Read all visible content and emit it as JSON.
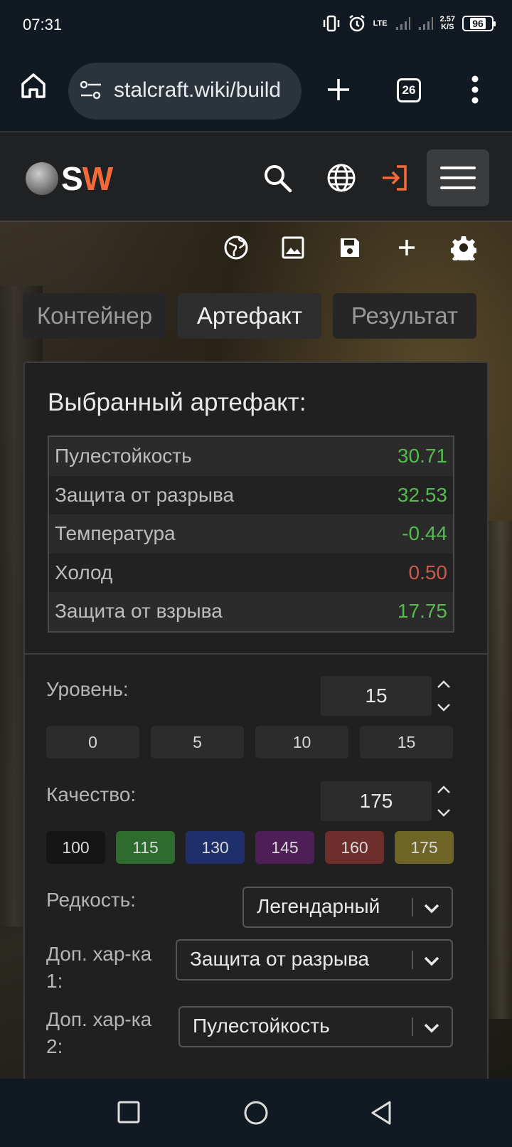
{
  "status_bar": {
    "time": "07:31",
    "network_label": "LTE",
    "net_speed_value": "2.57",
    "net_speed_unit": "K/S",
    "battery": "96"
  },
  "browser": {
    "url": "stalcraft.wiki/build",
    "tab_count": "26"
  },
  "site": {
    "logo_s": "S",
    "logo_w": "W"
  },
  "tabs": [
    {
      "label": "Контейнер"
    },
    {
      "label": "Артефакт"
    },
    {
      "label": "Результат"
    }
  ],
  "panel": {
    "title": "Выбранный артефакт:",
    "stats": [
      {
        "name": "Пулестойкость",
        "value": "30.71"
      },
      {
        "name": "Защита от разрыва",
        "value": "32.53"
      },
      {
        "name": "Температура",
        "value": "-0.44"
      },
      {
        "name": "Холод",
        "value": "0.50"
      },
      {
        "name": "Защита от взрыва",
        "value": "17.75"
      }
    ],
    "level": {
      "label": "Уровень:",
      "value": "15",
      "presets": [
        "0",
        "5",
        "10",
        "15"
      ]
    },
    "quality": {
      "label": "Качество:",
      "value": "175",
      "presets": [
        {
          "label": "100",
          "color": "#151515"
        },
        {
          "label": "115",
          "color": "#2d6b2e"
        },
        {
          "label": "130",
          "color": "#1f2f6b"
        },
        {
          "label": "145",
          "color": "#4e1f56"
        },
        {
          "label": "160",
          "color": "#6e2f2c"
        },
        {
          "label": "175",
          "color": "#6d6425"
        }
      ]
    },
    "rarity": {
      "label": "Редкость:",
      "value": "Легендарный"
    },
    "extra1": {
      "label_line1": "Доп. хар-ка",
      "label_line2": "1:",
      "value": "Защита от разрыва"
    },
    "extra2": {
      "label_line1": "Доп. хар-ка",
      "label_line2": "2:",
      "value": "Пулестойкость"
    }
  },
  "colors": {
    "accent": "#f26a3a",
    "positive": "#55bb4e",
    "negative": "#c85a4e"
  },
  "icons": [
    "home-icon",
    "site-settings-icon",
    "new-tab-icon",
    "tabs-icon",
    "more-vert-icon",
    "search-icon",
    "globe-icon",
    "login-icon",
    "hamburger-menu-icon",
    "globe-share-icon",
    "image-icon",
    "save-icon",
    "add-icon",
    "gear-icon",
    "nav-recents-icon",
    "nav-home-icon",
    "nav-back-icon"
  ]
}
